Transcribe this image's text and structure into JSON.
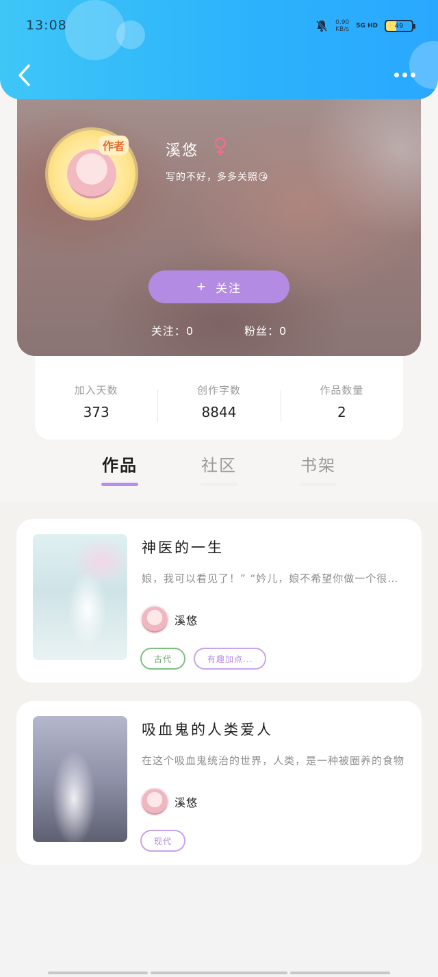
{
  "status_bar": {
    "time": "13:08",
    "net_speed_value": "0.90",
    "net_speed_unit": "KB/s",
    "signal": "5G HD",
    "battery": "49"
  },
  "header": {
    "back_icon": "chevron-left-icon",
    "more_icon": "more-dots-icon",
    "accent_color": "#2cb3fb"
  },
  "profile": {
    "author_badge": "作者",
    "name": "溪悠",
    "gender_icon": "female-icon",
    "gender_color": "#f26d8c",
    "bio": "写的不好，多多关照😘",
    "follow_button_icon": "+",
    "follow_button": "关注",
    "following_label": "关注：",
    "following_count": "0",
    "followers_label": "粉丝：",
    "followers_count": "0"
  },
  "stats": [
    {
      "label": "加入天数",
      "value": "373"
    },
    {
      "label": "创作字数",
      "value": "8844"
    },
    {
      "label": "作品数量",
      "value": "2"
    }
  ],
  "tabs": [
    {
      "label": "作品",
      "active": true
    },
    {
      "label": "社区",
      "active": false
    },
    {
      "label": "书架",
      "active": false
    }
  ],
  "works": [
    {
      "title": "神医的一生",
      "description": "娘，我可以看见了！”    “妗儿，娘不希望你做一个很厉害的医者",
      "author": "溪悠",
      "tags": [
        "古代",
        "有趣加点..."
      ]
    },
    {
      "title": "吸血鬼的人类爱人",
      "description": "在这个吸血鬼统治的世界，人类，是一种被圈养的食物",
      "author": "溪悠",
      "tags": [
        "现代"
      ]
    }
  ]
}
